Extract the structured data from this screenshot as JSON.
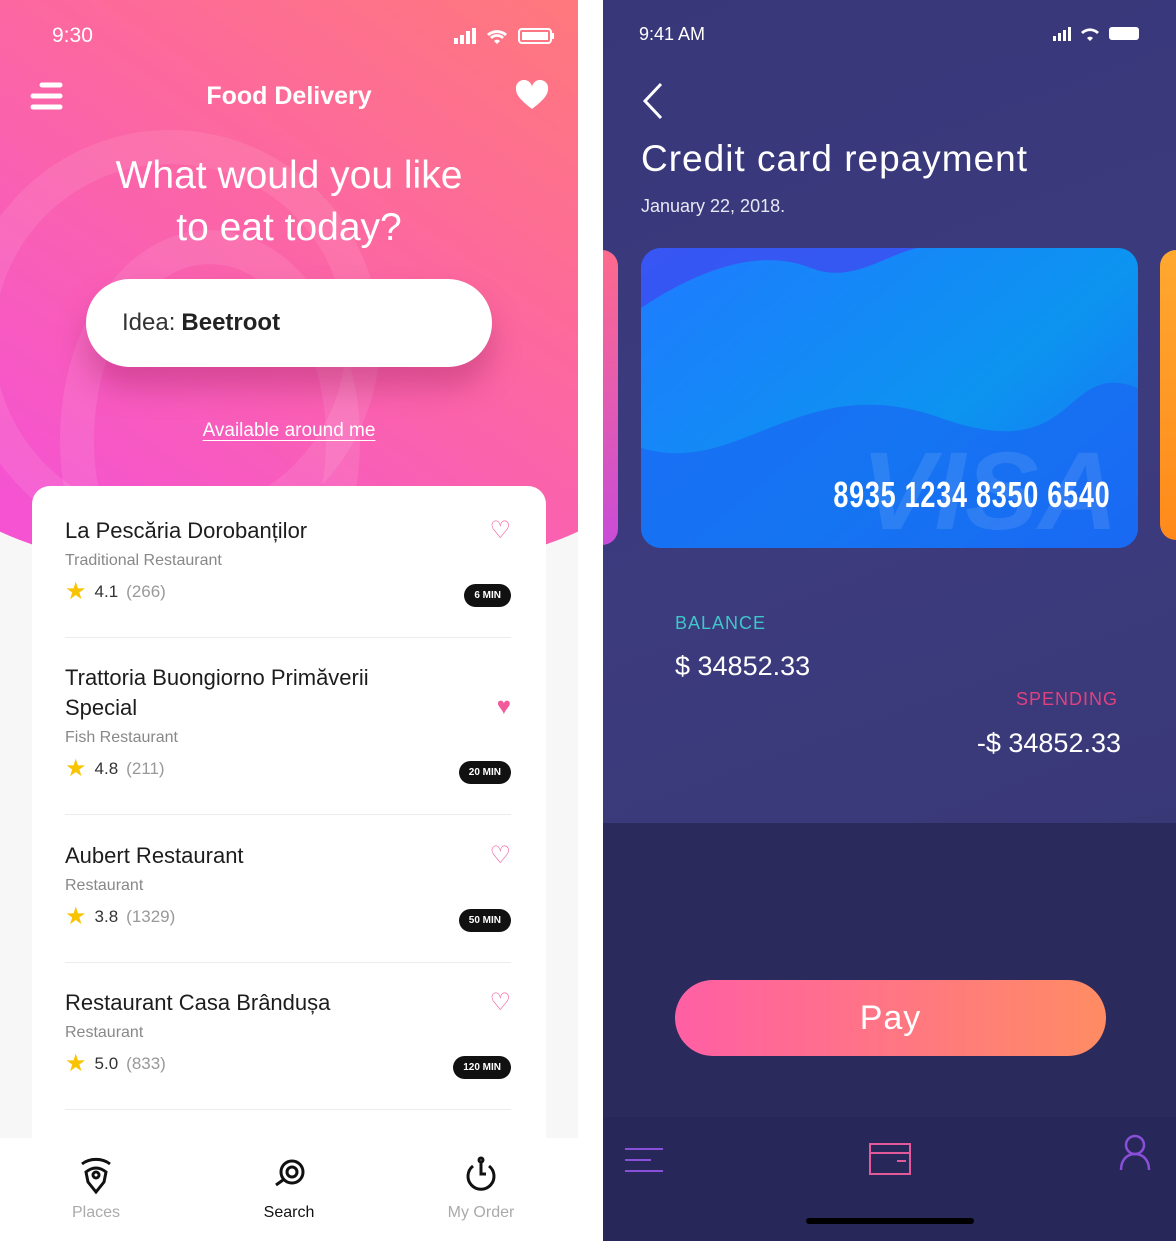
{
  "left": {
    "status": {
      "time": "9:30"
    },
    "header": {
      "title": "Food Delivery",
      "menu_icon": "menu-icon",
      "favorite_icon": "heart-icon"
    },
    "question": {
      "line1": "What would you like",
      "line2": "to eat today?"
    },
    "search": {
      "prefix": "Idea:",
      "value": "Beetroot"
    },
    "available_link": "Available around me",
    "restaurants": [
      {
        "name": "La Pescăria Dorobanților",
        "type": "Traditional Restaurant",
        "rating": "4.1",
        "count": "(266)",
        "time": "6 MIN",
        "favorite": false
      },
      {
        "name": "Trattoria Buongiorno Primăverii Special",
        "type": "Fish Restaurant",
        "rating": "4.8",
        "count": "(211)",
        "time": "20 MIN",
        "favorite": true
      },
      {
        "name": "Aubert Restaurant",
        "type": "Restaurant",
        "rating": "3.8",
        "count": "(1329)",
        "time": "50 MIN",
        "favorite": false
      },
      {
        "name": "Restaurant Casa Brândușa",
        "type": "Restaurant",
        "rating": "5.0",
        "count": "(833)",
        "time": "120 MIN",
        "favorite": false
      }
    ],
    "nav": [
      {
        "label": "Places",
        "icon": "places-icon"
      },
      {
        "label": "Search",
        "icon": "search-icon",
        "active": true
      },
      {
        "label": "My Order",
        "icon": "timer-icon"
      }
    ],
    "colors": {
      "gradient_start": "#f553d2",
      "gradient_end": "#ff8466",
      "heart": "#f15b9a",
      "star": "#f8c300"
    }
  },
  "right": {
    "status": {
      "time": "9:41 AM"
    },
    "title": "Credit card repayment",
    "date": "January 22, 2018.",
    "card": {
      "number": "8935 1234 8350 6540",
      "brand": "VISA"
    },
    "balance": {
      "label": "BALANCE",
      "value": "$ 34852.33"
    },
    "spending": {
      "label": "SPENDING",
      "value": "-$ 34852.33"
    },
    "pay_label": "Pay",
    "nav": [
      {
        "icon": "menu-icon"
      },
      {
        "icon": "card-icon",
        "active": true
      },
      {
        "icon": "user-icon"
      }
    ],
    "colors": {
      "background": "#3a3979",
      "balance_label": "#3fc6c9",
      "spending_label": "#e3407f",
      "pay_start": "#ff5fa4",
      "pay_end": "#ff8c63"
    }
  }
}
